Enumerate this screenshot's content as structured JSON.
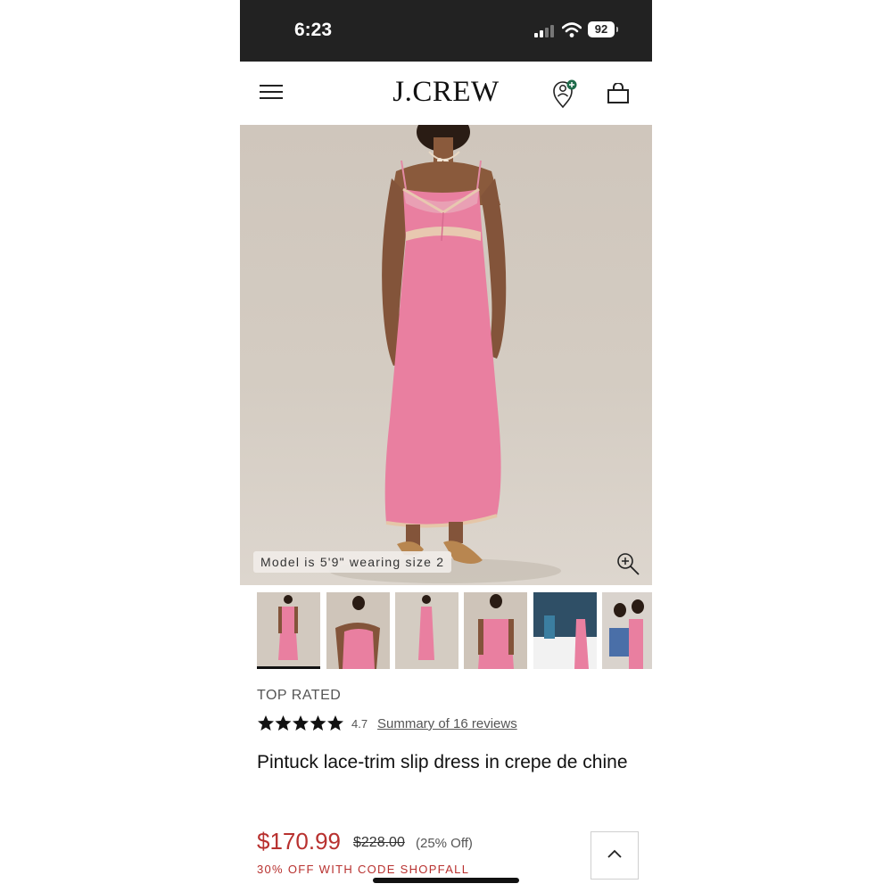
{
  "status_bar": {
    "time": "6:23",
    "battery": "92",
    "icons": [
      "signal-icon",
      "wifi-icon",
      "battery-icon"
    ]
  },
  "header": {
    "logo": "J.CREW",
    "icons": [
      "menu-icon",
      "account-icon",
      "shopping-bag-icon"
    ],
    "account_badge_color": "#1f6b4a"
  },
  "hero": {
    "model_caption": "Model is 5'9\" wearing size 2",
    "zoom_icon": "zoom-in-icon",
    "dress_color": "#e97fa0"
  },
  "thumbnails": {
    "count": 6,
    "active_index": 0
  },
  "product": {
    "badge": "TOP RATED",
    "rating": 4.7,
    "rating_display": "4.7",
    "stars_filled": 5,
    "reviews_link": "Summary of 16 reviews",
    "title": "Pintuck lace-trim slip dress in crepe de chine",
    "price_sale": "$170.99",
    "price_original": "$228.00",
    "discount": "(25% Off)",
    "promo": "30% OFF WITH CODE SHOPFALL",
    "sale_color": "#b8312f"
  },
  "back_to_top_icon": "chevron-up-icon"
}
